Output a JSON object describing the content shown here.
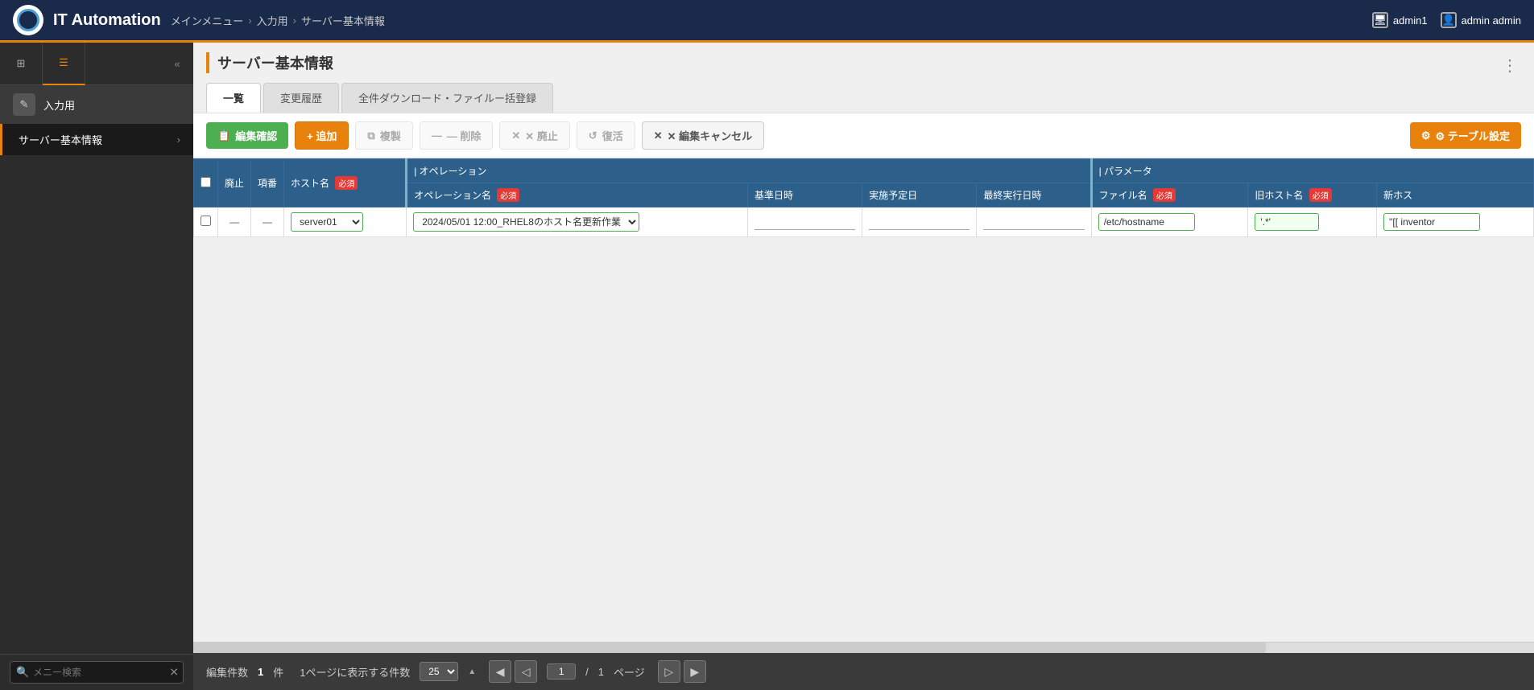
{
  "app": {
    "title": "IT Automation",
    "logo_alt": "IT Automation Logo"
  },
  "header": {
    "breadcrumb": {
      "menu": "メインメニュー",
      "sep1": "›",
      "input": "入力用",
      "sep2": "›",
      "page": "サーバー基本情報"
    },
    "user1_icon": "monitor-icon",
    "user1": "admin1",
    "user2_icon": "person-icon",
    "user2": "admin admin"
  },
  "sidebar": {
    "icons": [
      {
        "id": "grid-icon",
        "symbol": "⊞"
      },
      {
        "id": "list-icon",
        "symbol": "☰"
      }
    ],
    "collapse_symbol": "«",
    "section": {
      "icon": "✎",
      "label": "入力用"
    },
    "items": [
      {
        "label": "サーバー基本情報",
        "active": true
      }
    ],
    "search": {
      "placeholder": "メニー検索",
      "value": "",
      "clear_symbol": "✕"
    }
  },
  "page": {
    "title": "サーバー基本情報",
    "three_dots": "⋮",
    "tabs": [
      {
        "id": "tab-list",
        "label": "一覧",
        "active": true
      },
      {
        "id": "tab-history",
        "label": "変更履歴",
        "active": false
      },
      {
        "id": "tab-download",
        "label": "全件ダウンロード・ファイルー括登録",
        "active": false
      }
    ],
    "toolbar": {
      "confirm_edit_label": "編集確認",
      "add_label": "+ 追加",
      "copy_label": "複製",
      "delete_label": "― 削除",
      "discard_label": "✕ 廃止",
      "restore_label": "復活",
      "cancel_edit_label": "✕ 編集キャンセル",
      "table_settings_label": "⚙ テーブル設定"
    },
    "table": {
      "col_headers_row1": [
        {
          "id": "col-checkbox",
          "label": ""
        },
        {
          "id": "col-discard",
          "label": "廃止"
        },
        {
          "id": "col-seq",
          "label": "項番"
        },
        {
          "id": "col-hostname",
          "label": "ホスト名",
          "required": true
        },
        {
          "id": "col-operation-group",
          "label": "| オペレーション",
          "colspan": 4
        },
        {
          "id": "col-param-group",
          "label": "| パラメータ",
          "colspan": 3
        }
      ],
      "col_headers_row2": [
        {
          "id": "col-operation-name",
          "label": "オペレーション名",
          "required": true
        },
        {
          "id": "col-base-date",
          "label": "基準日時"
        },
        {
          "id": "col-scheduled-date",
          "label": "実施予定日"
        },
        {
          "id": "col-last-exec",
          "label": "最終実行日時"
        },
        {
          "id": "col-filename",
          "label": "ファイル名",
          "required": true
        },
        {
          "id": "col-old-hostname",
          "label": "旧ホスト名",
          "required": true
        },
        {
          "id": "col-new-hostname",
          "label": "新ホス"
        }
      ],
      "rows": [
        {
          "checkbox": false,
          "discard": "—",
          "seq": "—",
          "hostname": "server01",
          "hostname_options": [
            "server01"
          ],
          "operation": "2024/05/01 12:00_RHEL8のホスト名更新作業",
          "operation_options": [
            "2024/05/01 12:00_RHEL8のホスト名更新作業"
          ],
          "base_date": "",
          "scheduled_date": "",
          "last_exec": "",
          "filename": "/etc/hostname",
          "old_hostname": "'.*'",
          "new_hostname": "\"[[ inventor"
        }
      ]
    },
    "footer": {
      "edit_count_label": "編集件数",
      "edit_count": "1",
      "edit_count_unit": "件",
      "per_page_label": "1ページに表示する件数",
      "per_page_value": "25",
      "per_page_arrow": "▲",
      "page_current": "1",
      "page_sep": "/",
      "page_total": "1",
      "page_label": "ページ",
      "nav_first": "◀",
      "nav_prev": "◁",
      "nav_next": "▷",
      "nav_last": "▶"
    }
  }
}
